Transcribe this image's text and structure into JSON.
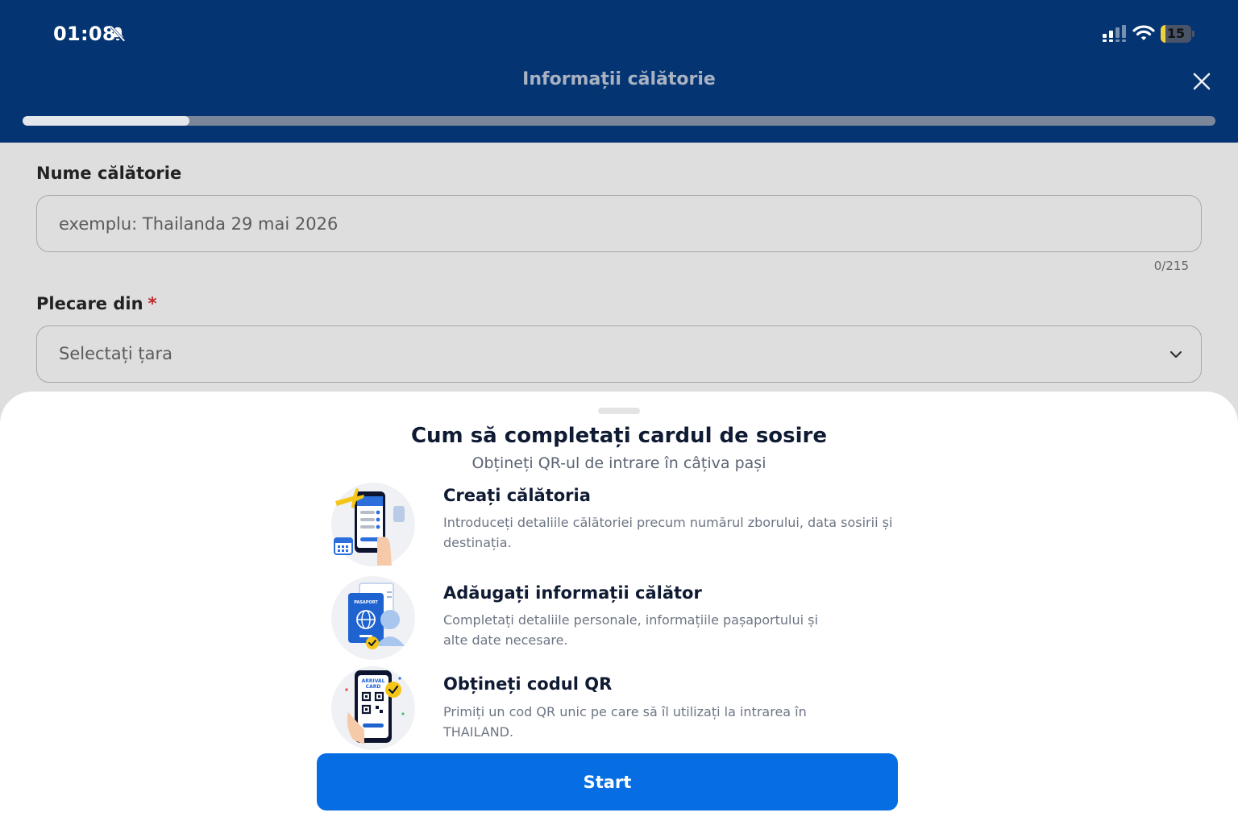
{
  "status_bar": {
    "time": "01:08",
    "battery_level": "15",
    "battery_fraction": 0.15,
    "icons": [
      "bell-slash-icon",
      "signal-icon",
      "wifi-icon",
      "battery-icon"
    ]
  },
  "header": {
    "title": "Informații călătorie",
    "close_icon": "close-icon",
    "progress_fraction": 0.14
  },
  "form": {
    "trip_name": {
      "label": "Nume călătorie",
      "placeholder": "exemplu: Thailanda 29 mai 2026",
      "value": "",
      "counter": "0/215"
    },
    "departure": {
      "label": "Plecare din",
      "required_mark": "*",
      "placeholder": "Selectați țara",
      "icon": "chevron-down-icon"
    }
  },
  "sheet": {
    "title": "Cum să completați cardul de sosire",
    "subtitle": "Obțineți QR-ul de intrare în câțiva pași",
    "steps": [
      {
        "title": "Creați călătoria",
        "description": "Introduceți detaliile călătoriei precum numărul zborului, data sosirii și destinația.",
        "icon": "phone-checklist-icon"
      },
      {
        "title": "Adăugați informații călător",
        "description": "Completați detaliile personale, informațiile pașaportului și alte date necesare.",
        "icon": "passport-icon",
        "icon_text": "PASAPORT"
      },
      {
        "title": "Obțineți codul QR",
        "description": "Primiți un cod QR unic pe care să îl utilizați la intrarea în THAILAND.",
        "icon": "qr-phone-icon",
        "icon_text_line1": "ARRIVAL",
        "icon_text_line2": "CARD"
      }
    ],
    "start_label": "Start"
  },
  "colors": {
    "header_bg": "#043572",
    "primary_button": "#066de3",
    "required": "#c2272d",
    "accent_yellow": "#f5c518"
  }
}
